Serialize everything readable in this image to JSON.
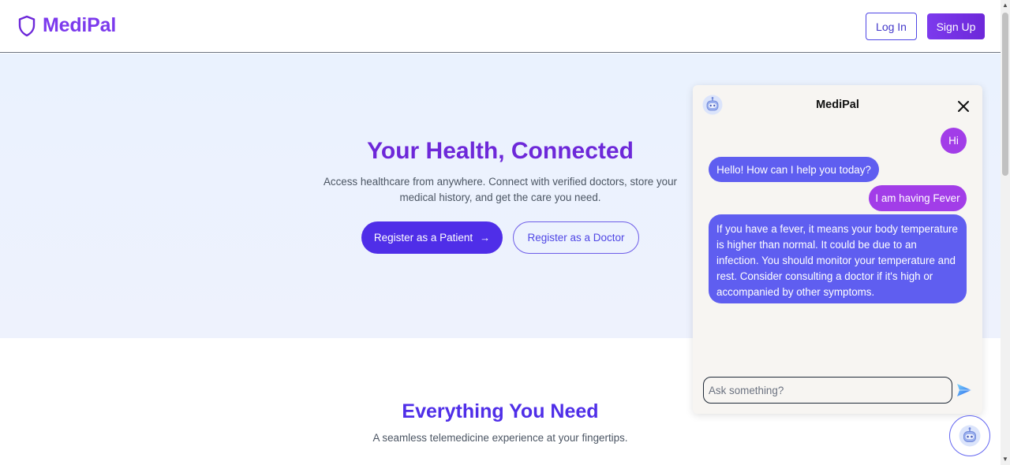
{
  "header": {
    "brand": "MediPal",
    "login_label": "Log In",
    "signup_label": "Sign Up"
  },
  "hero": {
    "title": "Your Health, Connected",
    "description": "Access healthcare from anywhere. Connect with verified doctors, store your medical history, and get the care you need.",
    "patient_button": "Register as a Patient",
    "patient_button_arrow": "→",
    "doctor_button": "Register as a Doctor"
  },
  "features": {
    "title": "Everything You Need",
    "subtitle": "A seamless telemedicine experience at your fingertips."
  },
  "chat": {
    "title": "MediPal",
    "messages": [
      {
        "role": "user",
        "text": "Hi"
      },
      {
        "role": "bot",
        "text": "Hello! How can I help you today?"
      },
      {
        "role": "user",
        "text": "I am having Fever"
      },
      {
        "role": "bot",
        "text": "If you have a fever, it means your body temperature is higher than normal. It could be due to an infection. You should monitor your temperature and rest. Consider consulting a doctor if it's high or accompanied by other symptoms."
      }
    ],
    "input_placeholder": "Ask something?",
    "input_value": ""
  },
  "icons": {
    "brand": "shield-icon",
    "chat_avatar": "robot-icon",
    "close": "close-icon",
    "send": "send-icon",
    "fab": "robot-icon"
  },
  "colors": {
    "brand": "#7c3aed",
    "primary": "#4f2ee8",
    "user_bubble": "#a23de8",
    "bot_bubble": "#5f5ef0",
    "hero_bg": "#eaf2fe"
  }
}
